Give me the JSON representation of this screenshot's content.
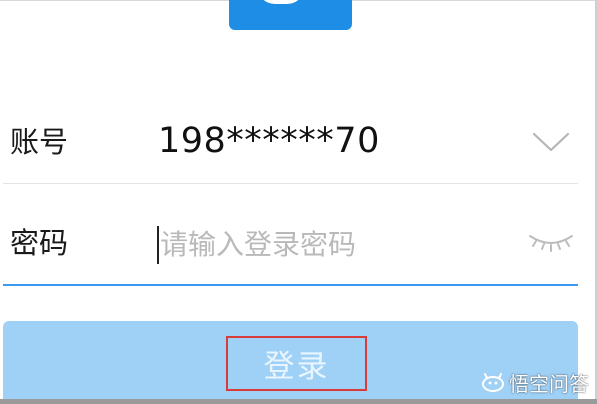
{
  "login_form": {
    "account_label": "账号",
    "account_value": "198******70",
    "password_label": "密码",
    "password_placeholder": "请输入登录密码",
    "login_button_label": "登录"
  },
  "icons": {
    "account_dropdown": "chevron-down-icon",
    "password_visibility": "eye-closed-icon",
    "app_logo": "logo-icon"
  },
  "watermark": {
    "text": "悟空问答"
  },
  "colors": {
    "logo_blue": "#1e8de6",
    "button_disabled": "#9fd0f6",
    "input_focus_line": "#3a9af2",
    "highlight_box": "#d93a3a",
    "placeholder": "#b9b9b9"
  }
}
